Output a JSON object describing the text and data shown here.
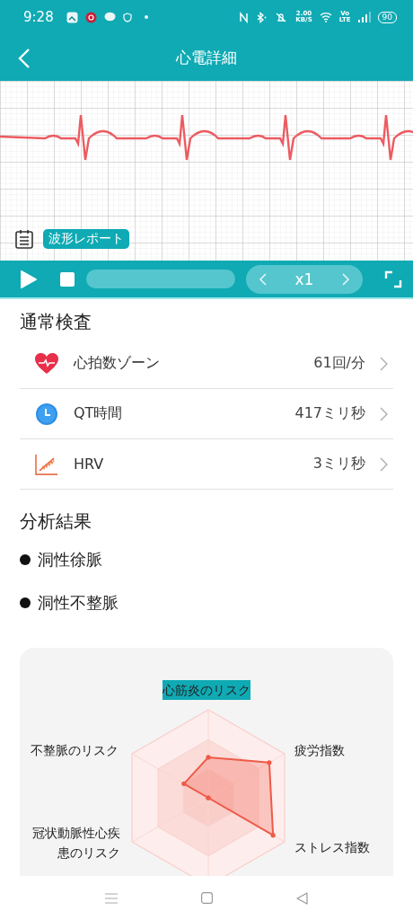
{
  "status_bar": {
    "time": "9:28",
    "speed": [
      "2.00",
      "KB/S"
    ],
    "network": [
      "Vo",
      "LTE"
    ],
    "battery": "90"
  },
  "header": {
    "title": "心電詳細"
  },
  "ecg": {
    "report_button": "波形レポート"
  },
  "player": {
    "speed": "x1"
  },
  "routine_check": {
    "title": "通常検査",
    "items": [
      {
        "kind": "heart",
        "label": "心拍数ゾーン",
        "value": "61回/分"
      },
      {
        "kind": "clock",
        "label": "QT時間",
        "value": "417ミリ秒"
      },
      {
        "kind": "trend",
        "label": "HRV",
        "value": "3ミリ秒"
      }
    ]
  },
  "analysis": {
    "title": "分析結果",
    "results": [
      "洞性徐脈",
      "洞性不整脈"
    ]
  },
  "risk_chart": {
    "axes": [
      "心筋炎のリスク",
      "不整脈のリスク",
      "疲労指数",
      "冠状動脈性心疾患のリスク",
      "ストレス指数"
    ]
  }
}
